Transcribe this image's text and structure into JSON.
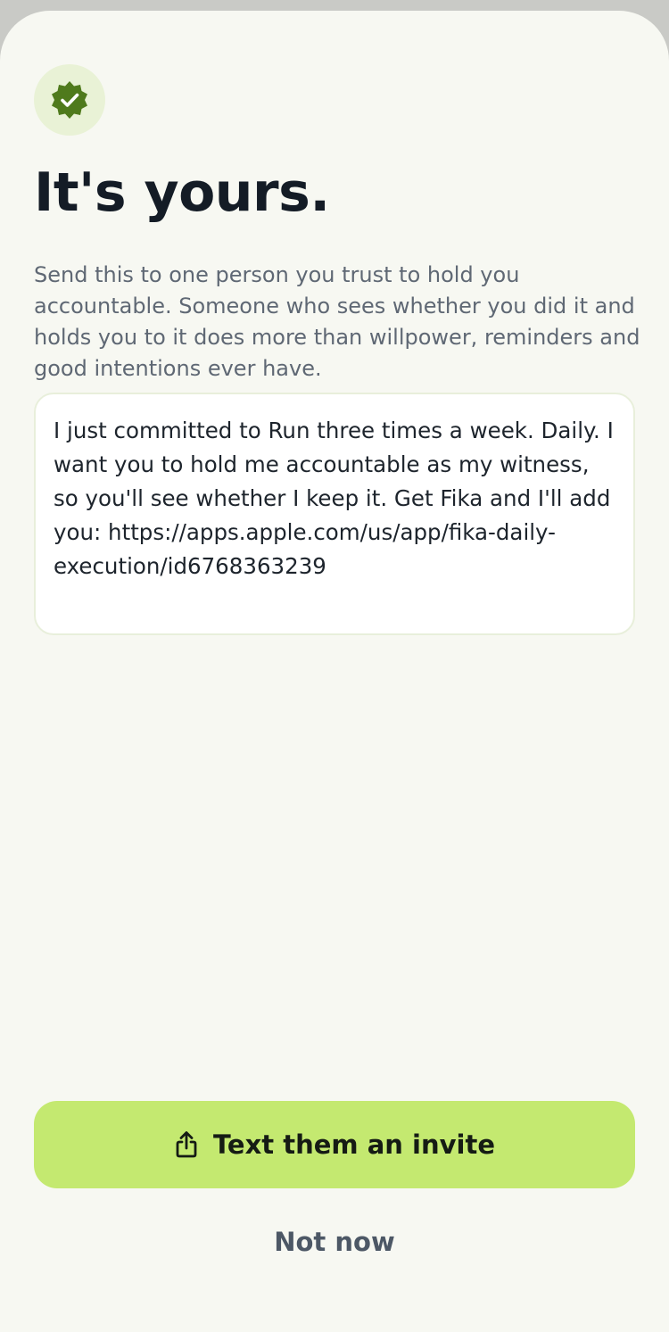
{
  "header": {
    "badge_icon": "verified-check-icon",
    "title": "It's yours."
  },
  "description": "Send this to one person you trust to hold you accountable. Someone who sees whether you did it and holds you to it does more than willpower, reminders and good intentions ever have.",
  "invite_message": "I just committed to Run three times a week. Daily. I want you to hold me accountable as my witness, so you'll see whether I keep it. Get Fika and I'll add you: https://apps.apple.com/us/app/fika-daily-execution/id6768363239",
  "actions": {
    "primary_icon": "share-icon",
    "primary_label": "Text them an invite",
    "secondary_label": "Not now"
  },
  "colors": {
    "background": "#f7f8f2",
    "accent": "#c4e970",
    "badge": "#4f7a1c",
    "title": "#141c26"
  }
}
